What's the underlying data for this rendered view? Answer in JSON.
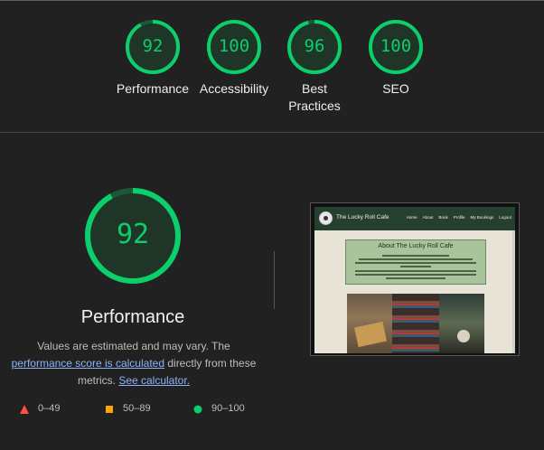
{
  "categories": [
    {
      "score": "92",
      "label_lines": [
        "Performance"
      ]
    },
    {
      "score": "100",
      "label_lines": [
        "Accessibility"
      ]
    },
    {
      "score": "96",
      "label_lines": [
        "Best",
        "Practices"
      ]
    },
    {
      "score": "100",
      "label_lines": [
        "SEO"
      ]
    }
  ],
  "performance": {
    "score": "92",
    "title": "Performance",
    "desc_prefix": "Values are estimated and may vary. The ",
    "desc_link1": "performance score is calculated",
    "desc_middle": " directly from these metrics. ",
    "desc_link2": "See calculator."
  },
  "legend": [
    {
      "range": "0–49",
      "color": "#ff4e42",
      "shape": "triangle"
    },
    {
      "range": "50–89",
      "color": "#ffa400",
      "shape": "square"
    },
    {
      "range": "90–100",
      "color": "#0cce6b",
      "shape": "circle"
    }
  ],
  "screenshot": {
    "site_name": "The Lucky Roll Cafe",
    "nav_links": [
      "Home",
      "About",
      "Book",
      "Profile",
      "My Bookings",
      "Logout"
    ],
    "about_title": "About The Lucky Roll Cafe"
  },
  "colors": {
    "pass": "#0cce6b",
    "background": "#212121",
    "link": "#8ab4f8"
  }
}
